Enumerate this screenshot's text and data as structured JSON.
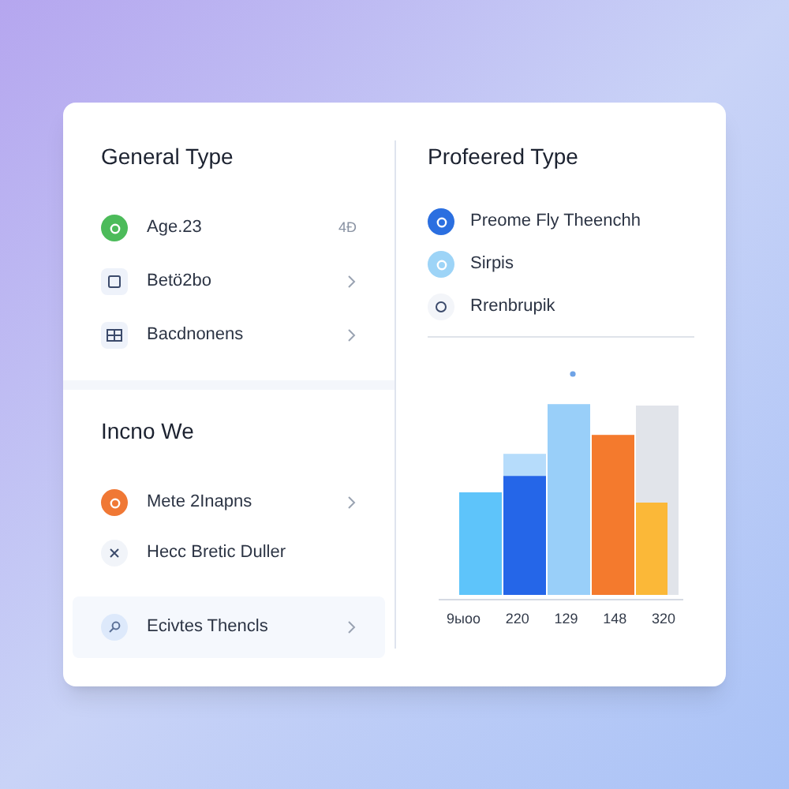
{
  "left": {
    "sections": [
      {
        "title": "General Type",
        "items": [
          {
            "kind": "badge",
            "color": "#4cbb5a",
            "label": "Age.23",
            "trailing": "4Ð",
            "chevron": false,
            "selected": false
          },
          {
            "kind": "tile",
            "label": "Betö2bo",
            "chevron": true,
            "selected": false
          },
          {
            "kind": "grid",
            "label": "Bacdnonens",
            "chevron": true,
            "selected": false
          }
        ]
      },
      {
        "title": "Incno We",
        "items": [
          {
            "kind": "badge",
            "color": "#f07835",
            "label": "Mete 2Inapns",
            "chevron": true,
            "selected": false
          },
          {
            "kind": "cross",
            "label": "Hecc Bretic Duller",
            "chevron": false,
            "selected": false
          },
          {
            "kind": "search",
            "label": "Ecivtes Thencls",
            "chevron": true,
            "selected": true
          }
        ]
      }
    ]
  },
  "right": {
    "title": "Profeered Type",
    "items": [
      {
        "kind": "badge",
        "color": "#2b6fe0",
        "label": "Preome Fly Theenchh"
      },
      {
        "kind": "badge",
        "color": "#9dd4f7",
        "label": "Sirpis"
      },
      {
        "kind": "ring",
        "label": "Rrenbrupik"
      }
    ],
    "chart": {
      "labels": [
        "9ыoo",
        "220",
        "129",
        "148",
        "320"
      ]
    }
  }
}
